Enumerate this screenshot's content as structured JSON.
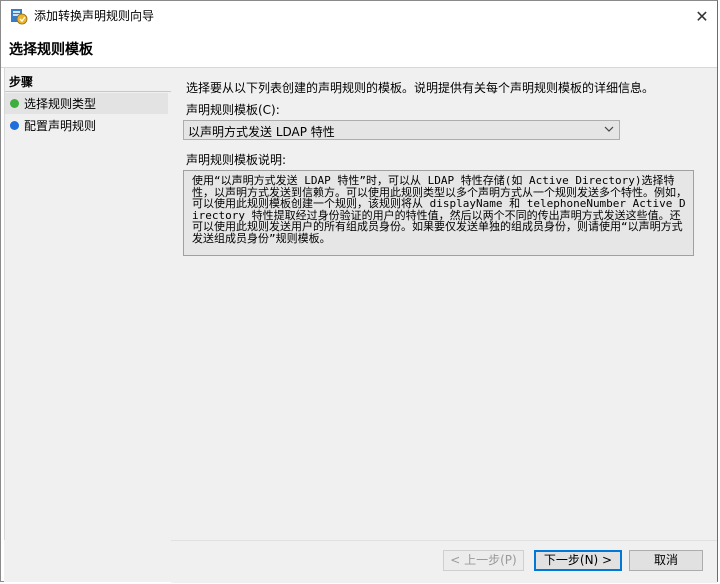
{
  "window": {
    "title": "添加转换声明规则向导",
    "close_symbol": "✕"
  },
  "header": {
    "page_title": "选择规则模板"
  },
  "steps": {
    "heading": "步骤",
    "items": [
      {
        "label": "选择规则类型",
        "status_color": "#3fae3f",
        "active": true
      },
      {
        "label": "配置声明规则",
        "status_color": "#1e6fd9",
        "active": false
      }
    ]
  },
  "main": {
    "intro": "选择要从以下列表创建的声明规则的模板。说明提供有关每个声明规则模板的详细信息。",
    "template_label": "声明规则模板(C):",
    "template_selected": "以声明方式发送 LDAP 特性",
    "description_label": "声明规则模板说明:",
    "description": "使用“以声明方式发送 LDAP 特性”时，可以从 LDAP 特性存储(如 Active Directory)选择特性，以声明方式发送到信赖方。可以使用此规则类型以多个声明方式从一个规则发送多个特性。例如，可以使用此规则模板创建一个规则，该规则将从 displayName 和 telephoneNumber Active Directory 特性提取经过身份验证的用户的特性值，然后以两个不同的传出声明方式发送这些值。还可以使用此规则发送用户的所有组成员身份。如果要仅发送单独的组成员身份，则请使用“以声明方式发送组成员身份”规则模板。"
  },
  "footer": {
    "back_label": "< 上一步(P)",
    "next_label": "下一步(N) >",
    "cancel_label": "取消"
  }
}
